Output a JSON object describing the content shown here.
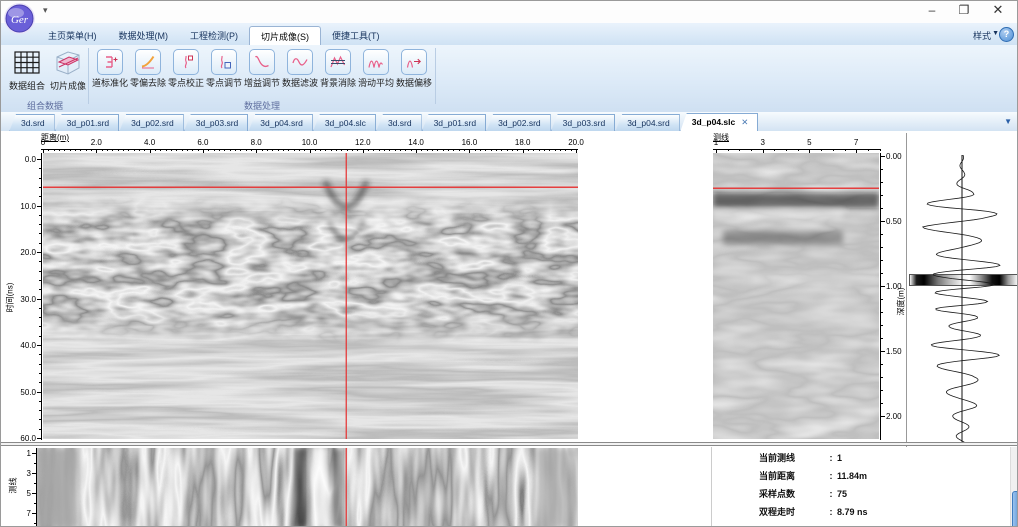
{
  "window": {
    "logo_text": "Ger",
    "quick_access_arrow": "▾",
    "controls": {
      "minimize": "–",
      "maximize": "❐",
      "close": "✕"
    }
  },
  "menu": {
    "tabs": [
      "主页菜单(H)",
      "数据处理(M)",
      "工程检测(P)",
      "切片成像(S)",
      "便捷工具(T)"
    ],
    "active_index": 3,
    "style_button": "样式",
    "style_arrow": "▼",
    "help_glyph": "?"
  },
  "ribbon": {
    "groups": [
      {
        "label": "组合数据",
        "buttons": [
          {
            "label": "数据组合",
            "icon": "data-grid-icon"
          },
          {
            "label": "切片成像",
            "icon": "slice-cube-icon"
          }
        ]
      },
      {
        "label": "数据处理",
        "buttons": [
          {
            "label": "道标准化",
            "icon": "trace-normalize-icon"
          },
          {
            "label": "零偏去除",
            "icon": "dc-removal-icon"
          },
          {
            "label": "零点校正",
            "icon": "zero-correct-icon"
          },
          {
            "label": "零点调节",
            "icon": "zero-adjust-icon"
          },
          {
            "label": "增益调节",
            "icon": "gain-adjust-icon"
          },
          {
            "label": "数据滤波",
            "icon": "data-filter-icon"
          },
          {
            "label": "背景消除",
            "icon": "background-removal-icon"
          },
          {
            "label": "滑动平均",
            "icon": "moving-average-icon"
          },
          {
            "label": "数据偏移",
            "icon": "data-shift-icon"
          }
        ]
      }
    ]
  },
  "file_tabs": {
    "tabs": [
      "3d.srd",
      "3d_p01.srd",
      "3d_p02.srd",
      "3d_p03.srd",
      "3d_p04.srd",
      "3d_p04.slc",
      "3d.srd",
      "3d_p01.srd",
      "3d_p02.srd",
      "3d_p03.srd",
      "3d_p04.srd",
      "3d_p04.slc"
    ],
    "active_index": 11,
    "close_glyph": "✕",
    "overflow_arrow": "▼"
  },
  "main_view": {
    "title": "距离(m)",
    "x_ticks": [
      "0",
      "2.0",
      "4.0",
      "6.0",
      "8.0",
      "10.0",
      "12.0",
      "14.0",
      "16.0",
      "18.0",
      "20.0"
    ],
    "y_label": "时间(ns)",
    "y_ticks": [
      "0.0",
      "10.0",
      "20.0",
      "30.0",
      "40.0",
      "50.0",
      "60.0"
    ]
  },
  "line_view": {
    "title": "测线",
    "x_ticks": [
      "1",
      "3",
      "5",
      "7"
    ],
    "y_label": "深度(m)",
    "y_ticks": [
      "0.00",
      "0.50",
      "1.00",
      "1.50",
      "2.00"
    ]
  },
  "slice_view": {
    "y_label": "测线",
    "y_ticks": [
      "1",
      "3",
      "5",
      "7"
    ]
  },
  "info_panel": {
    "rows": [
      {
        "label": "当前测线",
        "value": "1"
      },
      {
        "label": "当前距离",
        "value": "11.84m"
      },
      {
        "label": "采样点数",
        "value": "75"
      },
      {
        "label": "双程走时",
        "value": "8.79 ns"
      }
    ]
  },
  "colors": {
    "accent_blue": "#4d8fd6",
    "crosshair_red": "#e43b3b",
    "ribbon_glyph_pink": "#e8608a"
  }
}
